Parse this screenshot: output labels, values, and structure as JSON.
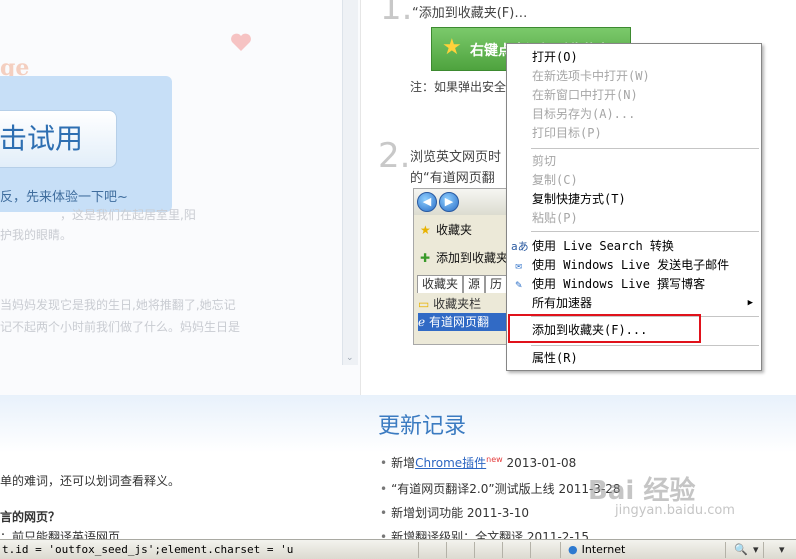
{
  "left_page": {
    "brand_partial": "ge",
    "trial_button": "击试用",
    "promo_sub": "反，先来体验一下吧~",
    "faded_lines": [
      "，这是我们在起居室里,阳",
      "护我的眼睛。",
      "当妈妈发现它是我的生日,她将推翻了,她忘记",
      "记不起两个小时前我们做了什么。妈妈生日是"
    ]
  },
  "tutorial": {
    "step1_number": "1.",
    "step1_text": "“添加到收藏夹(F)…",
    "green_button": "右键点击添加到收藏夹",
    "note": "注：如果弹出安全",
    "step2_number": "2.",
    "step2_line1": "浏览英文网页时",
    "step2_line2": "的“有道网页翻"
  },
  "ie_screenshot": {
    "back_glyph": "◀",
    "forward_glyph": "▶",
    "toolbar_btn": "收藏夹",
    "add_fav": "添加到收藏夹",
    "tabs": [
      "收藏夹",
      "源",
      "历"
    ],
    "items": [
      "收藏夹栏",
      "有道网页翻"
    ]
  },
  "context_menu": {
    "items": [
      {
        "label": "打开(O)",
        "disabled": false,
        "icon": ""
      },
      {
        "label": "在新选项卡中打开(W)",
        "disabled": true,
        "icon": ""
      },
      {
        "label": "在新窗口中打开(N)",
        "disabled": true,
        "icon": ""
      },
      {
        "label": "目标另存为(A)...",
        "disabled": true,
        "icon": ""
      },
      {
        "label": "打印目标(P)",
        "disabled": true,
        "icon": ""
      },
      {
        "label": "剪切",
        "disabled": true,
        "icon": ""
      },
      {
        "label": "复制(C)",
        "disabled": true,
        "icon": ""
      },
      {
        "label": "复制快捷方式(T)",
        "disabled": false,
        "icon": ""
      },
      {
        "label": "粘贴(P)",
        "disabled": true,
        "icon": ""
      },
      {
        "label": "使用 Live Search 转换",
        "disabled": false,
        "icon": "aあ"
      },
      {
        "label": "使用 Windows Live 发送电子邮件",
        "disabled": false,
        "icon": "✉"
      },
      {
        "label": "使用 Windows Live 撰写博客",
        "disabled": false,
        "icon": "✎"
      },
      {
        "label": "所有加速器",
        "disabled": false,
        "icon": ""
      },
      {
        "label": "添加到收藏夹(F)...",
        "disabled": false,
        "icon": ""
      },
      {
        "label": "属性(R)",
        "disabled": false,
        "icon": ""
      }
    ],
    "submenu_arrow": "▶"
  },
  "updates": {
    "title": "更新记录",
    "items": [
      {
        "prefix": "新增",
        "link": "Chrome插件",
        "badge": "new",
        "date": "2013-01-08"
      },
      {
        "prefix": "“有道网页翻译2.0”测试版上线",
        "link": "",
        "badge": "",
        "date": "2011-3-28"
      },
      {
        "prefix": "新增划词功能",
        "link": "",
        "badge": "",
        "date": "2011-3-10"
      },
      {
        "prefix": "新增翻译级别：全文翻译",
        "link": "",
        "badge": "",
        "date": "2011-2-15"
      }
    ],
    "bullet": "•"
  },
  "left_bottom": {
    "line1": "单的难词，还可以划词查看释义。",
    "line2": "言的网页？",
    "line3": "：前只能翻译英语网页"
  },
  "watermark": {
    "main": "Bai 经验",
    "sub": "jingyan.baidu.com"
  },
  "status_bar": {
    "script_text": "t.id = 'outfox_seed_js';element.charset = 'u",
    "zone": "Internet",
    "zone_icon": "globe-icon",
    "zoom_glyph": "🔍",
    "dropdown": "▾"
  }
}
